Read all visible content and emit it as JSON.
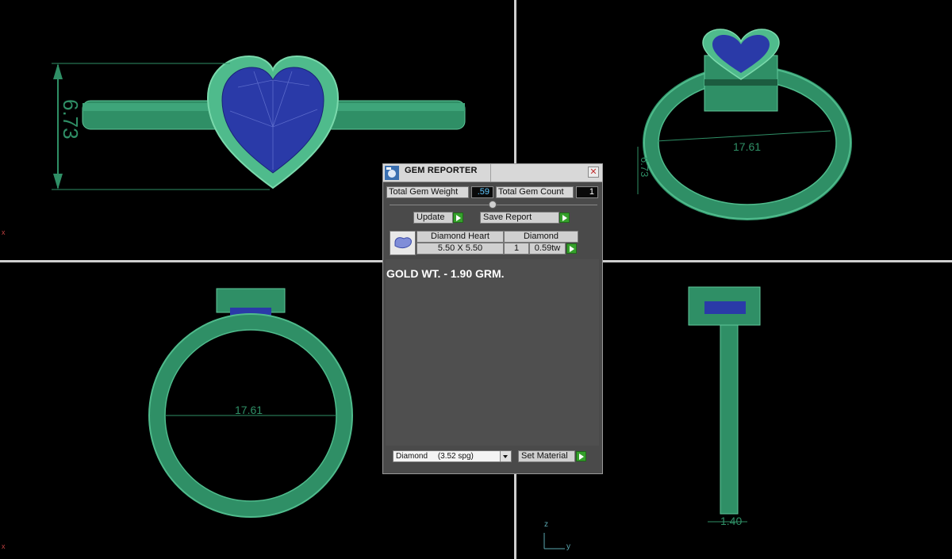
{
  "viewports": {
    "top_left": {
      "dimension": "6.73"
    },
    "top_right": {
      "dimension_diameter": "17.61",
      "dimension_height": "6.73"
    },
    "bottom_left": {
      "dimension": "17.61"
    },
    "bottom_right": {
      "dimension": "1.40"
    }
  },
  "axis_labels": {
    "z": "z",
    "y": "y",
    "x_marker": "x"
  },
  "gem_reporter": {
    "title": "GEM REPORTER",
    "close_icon": "close-icon",
    "total_gem_weight_label": "Total Gem Weight",
    "total_gem_weight_value": ".59",
    "total_gem_count_label": "Total Gem Count",
    "total_gem_count_value": "1",
    "update_label": "Update",
    "save_report_label": "Save Report",
    "gem_table": {
      "headers": [
        "Diamond Heart",
        "Diamond"
      ],
      "row": {
        "size": "5.50 X 5.50",
        "count": "1",
        "weight": "0.59tw"
      }
    },
    "gold_weight_text": "GOLD WT. - 1.90 GRM.",
    "material_select": {
      "value": "Diamond",
      "density": "(3.52 spg)"
    },
    "set_material_label": "Set Material"
  },
  "colors": {
    "metal": "#2f8f66",
    "metal_light": "#4fbb8c",
    "gem": "#2a3aa8",
    "background": "#000000",
    "divider": "#cfcfcf",
    "accent_green": "#35a02b"
  }
}
